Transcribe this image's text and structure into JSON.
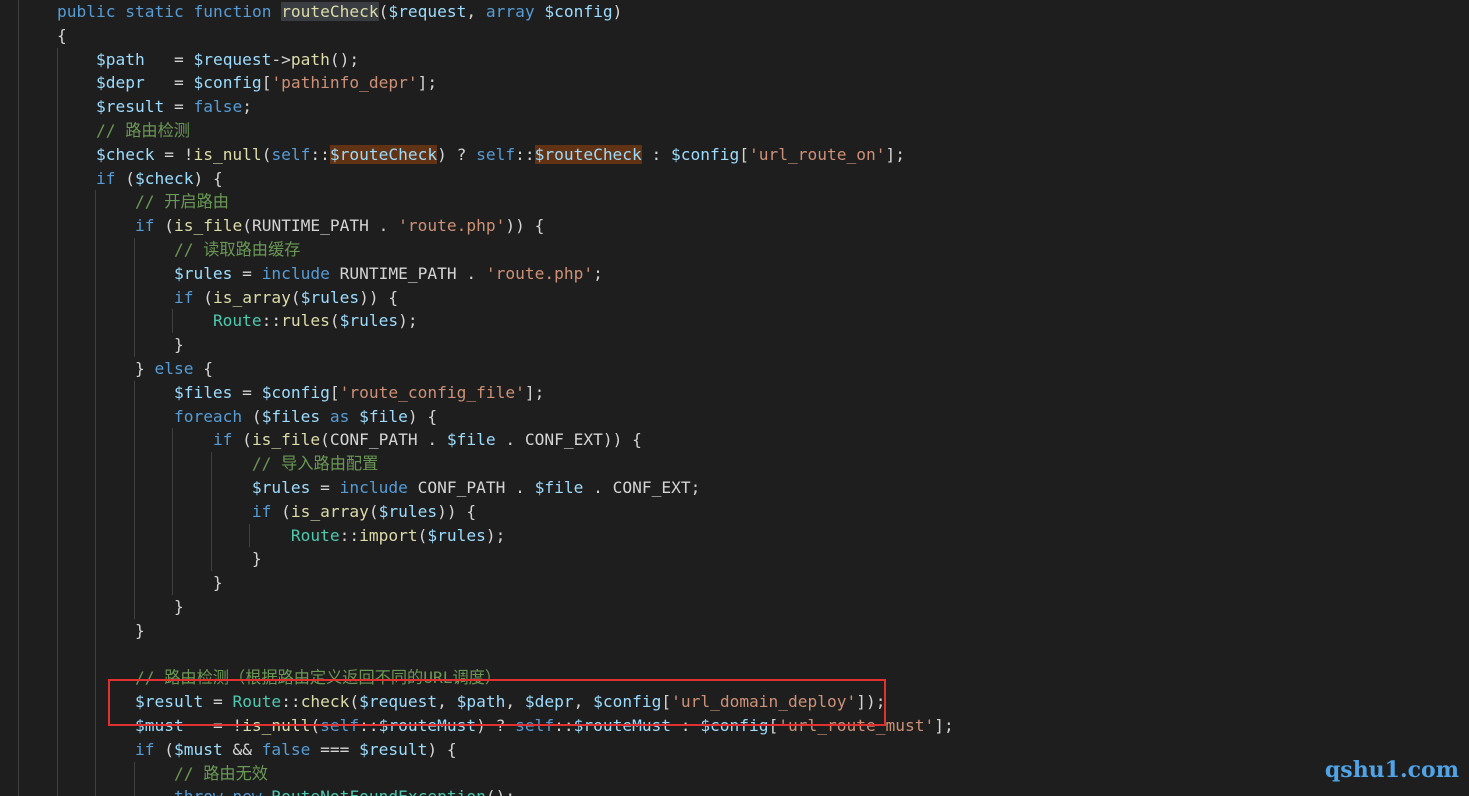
{
  "editor": {
    "language": "php",
    "theme_colors": {
      "background": "#1e1e1e",
      "keyword": "#569cd6",
      "variable": "#9cdcfe",
      "string": "#ce9178",
      "comment": "#6a9955",
      "function": "#dcdcaa",
      "class": "#4ec9b0",
      "highlight_box": "#e03030"
    },
    "lines": [
      "public static function routeCheck($request, array $config)",
      "{",
      "    $path   = $request->path();",
      "    $depr   = $config['pathinfo_depr'];",
      "    $result = false;",
      "    // 路由检测",
      "    $check = !is_null(self::$routeCheck) ? self::$routeCheck : $config['url_route_on'];",
      "    if ($check) {",
      "        // 开启路由",
      "        if (is_file(RUNTIME_PATH . 'route.php')) {",
      "            // 读取路由缓存",
      "            $rules = include RUNTIME_PATH . 'route.php';",
      "            if (is_array($rules)) {",
      "                Route::rules($rules);",
      "            }",
      "        } else {",
      "            $files = $config['route_config_file'];",
      "            foreach ($files as $file) {",
      "                if (is_file(CONF_PATH . $file . CONF_EXT)) {",
      "                    // 导入路由配置",
      "                    $rules = include CONF_PATH . $file . CONF_EXT;",
      "                    if (is_array($rules)) {",
      "                        Route::import($rules);",
      "                    }",
      "                }",
      "            }",
      "        }",
      "",
      "        // 路由检测（根据路由定义返回不同的URL调度）",
      "        $result = Route::check($request, $path, $depr, $config['url_domain_deploy']);",
      "        $must   = !is_null(self::$routeMust) ? self::$routeMust : $config['url_route_must'];",
      "        if ($must && false === $result) {",
      "            // 路由无效",
      "            throw new RouteNotFoundException();"
    ],
    "highlighted_line": "$result = Route::check($request, $path, $depr, $config['url_domain_deploy']);"
  },
  "watermark": "qshu1.com"
}
